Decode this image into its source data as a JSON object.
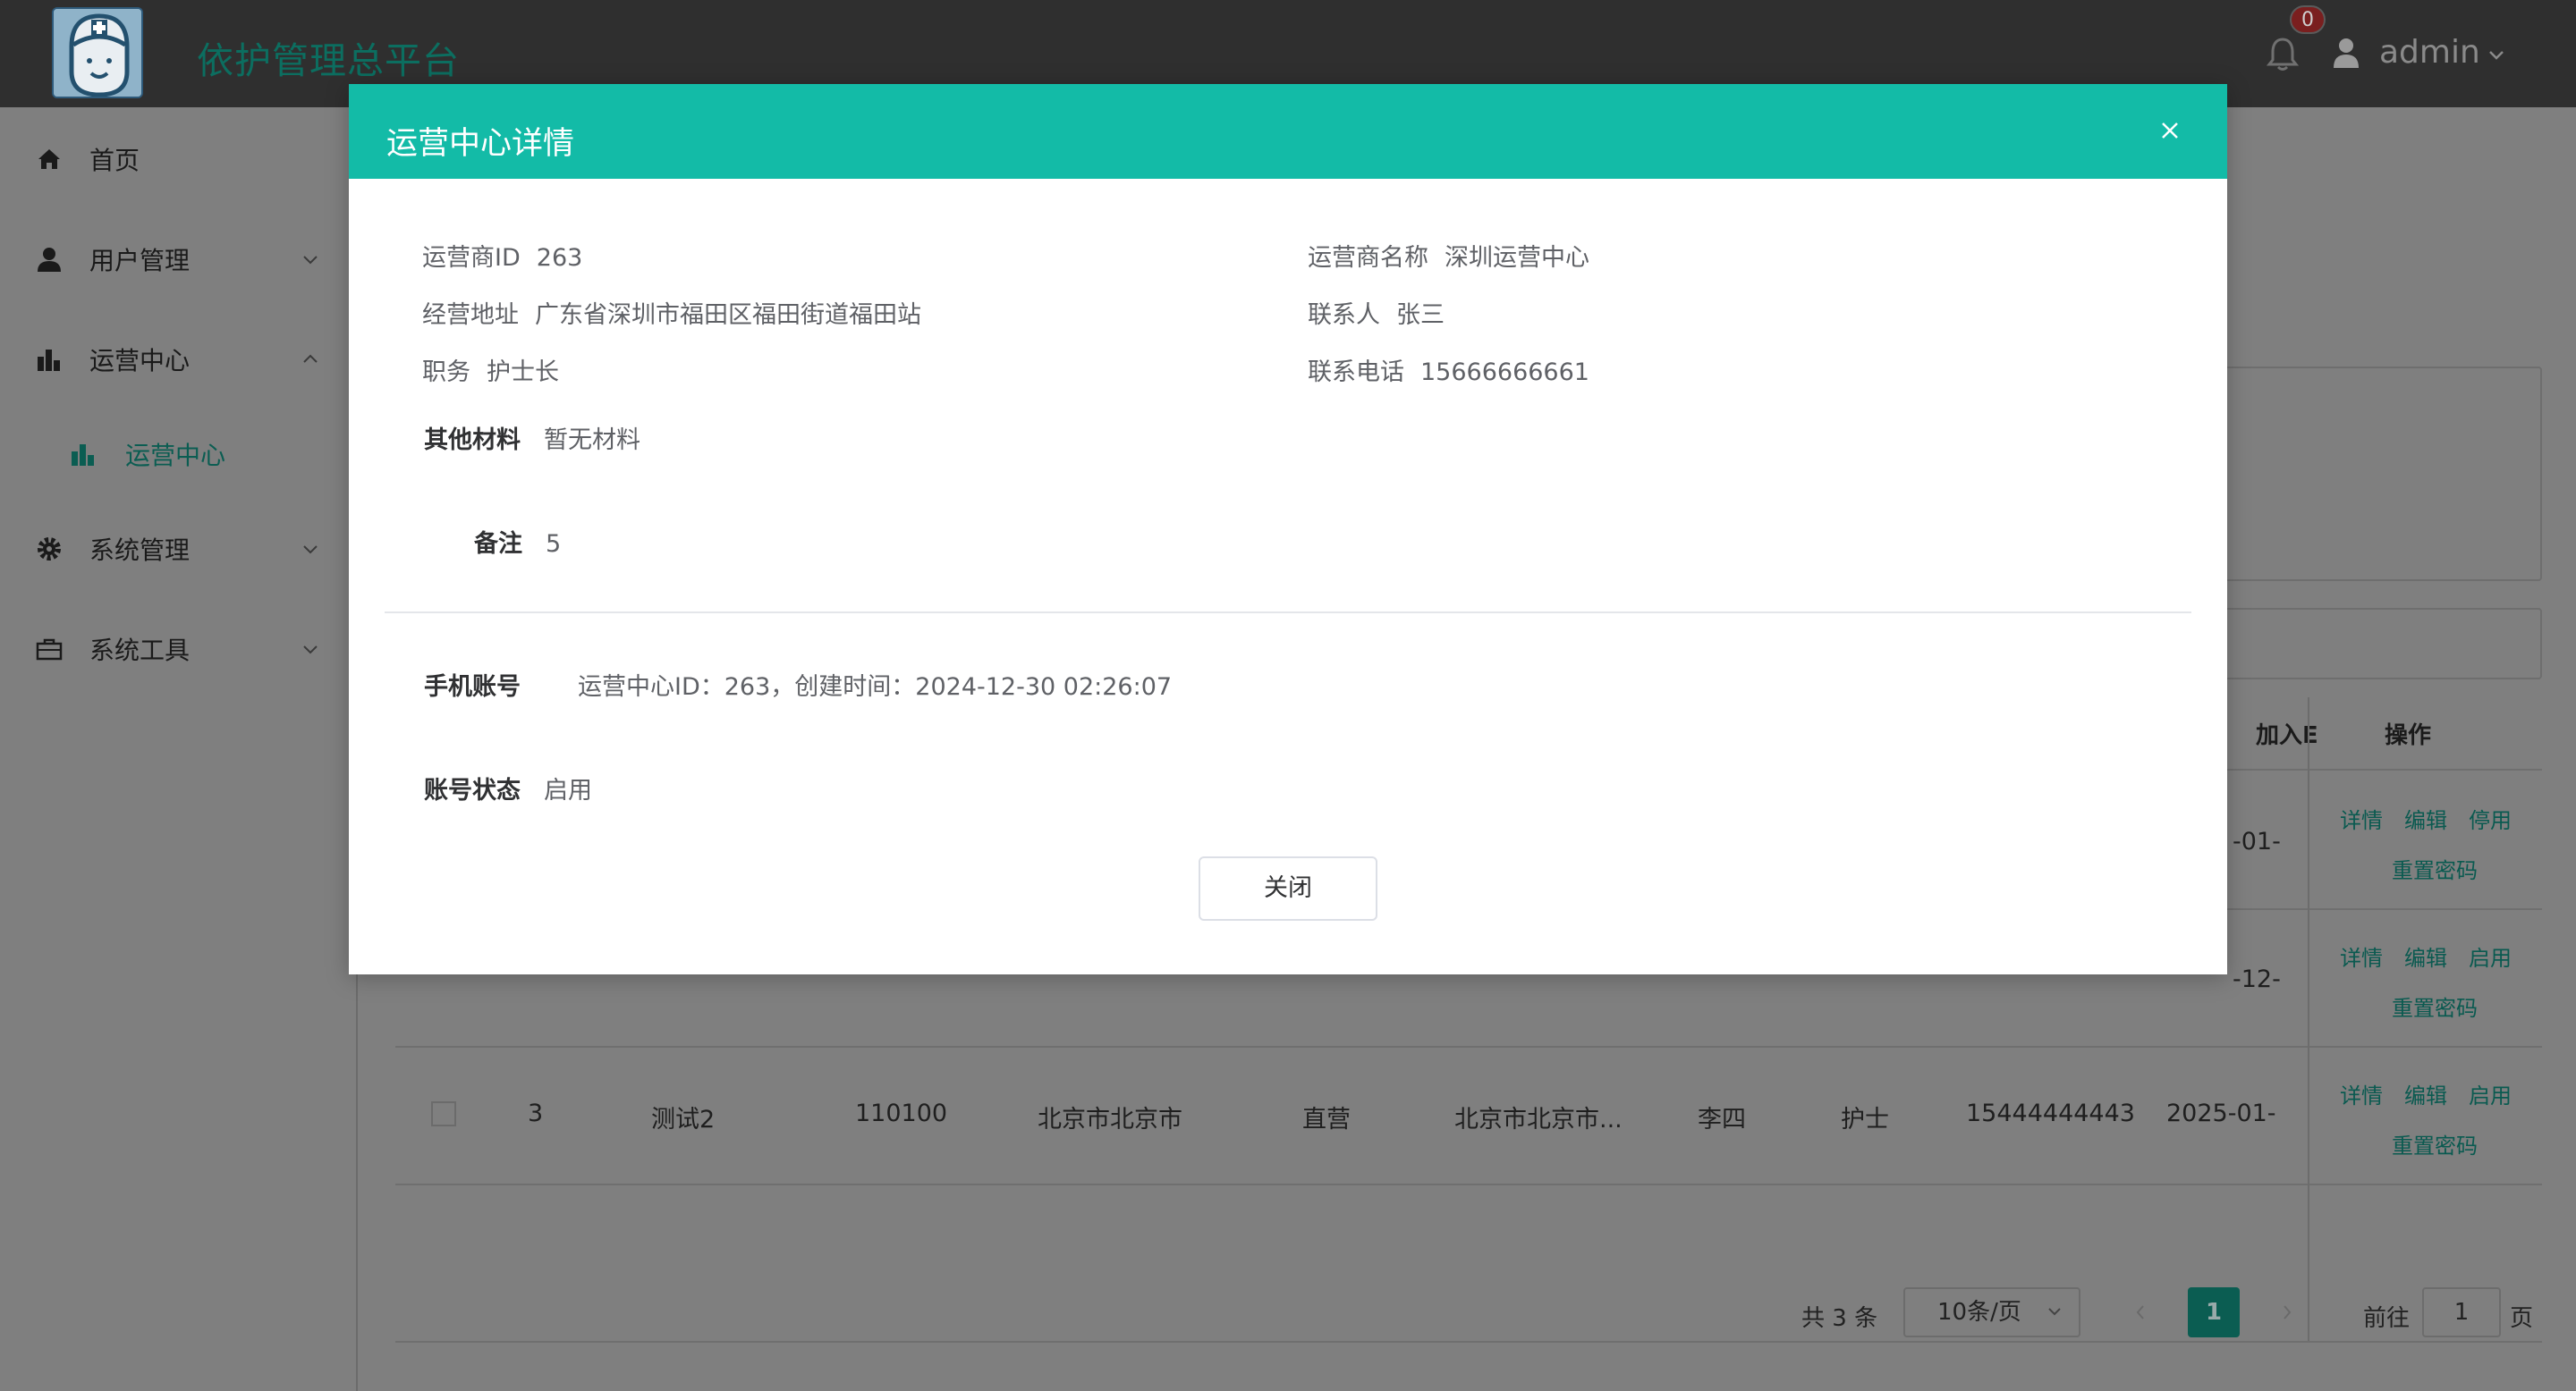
{
  "header": {
    "brand": "依护管理总平台",
    "notification_count": "0",
    "username": "admin"
  },
  "sidebar": {
    "items": [
      {
        "label": "首页",
        "icon": "home-icon"
      },
      {
        "label": "用户管理",
        "icon": "user-icon"
      },
      {
        "label": "运营中心",
        "icon": "bar-chart-icon"
      },
      {
        "label": "运营中心",
        "icon": "bar-chart-icon"
      },
      {
        "label": "系统管理",
        "icon": "gear-icon"
      },
      {
        "label": "系统工具",
        "icon": "toolbox-icon"
      }
    ]
  },
  "table": {
    "headers": {
      "join_partial": "加入E",
      "ops": "操作"
    },
    "rows": [
      {
        "date_partial": "-01-",
        "ops": [
          "详情",
          "编辑",
          "停用"
        ],
        "reset": "重置密码"
      },
      {
        "date_partial": "-12-",
        "ops": [
          "详情",
          "编辑",
          "启用"
        ],
        "reset": "重置密码"
      },
      {
        "index": "3",
        "name": "测试2",
        "code": "110100",
        "region": "北京市北京市",
        "type": "直营",
        "address": "北京市北京市...",
        "contact": "李四",
        "position": "护士",
        "phone": "15444444443",
        "date": "2025-01-",
        "ops": [
          "详情",
          "编辑",
          "启用"
        ],
        "reset": "重置密码"
      }
    ]
  },
  "pagination": {
    "total": "共 3 条",
    "page_size": "10条/页",
    "current_page": "1",
    "goto_label": "前往",
    "goto_value": "1",
    "page_suffix": "页"
  },
  "modal": {
    "title": "运营中心详情",
    "fields": {
      "operator_id_label": "运营商ID",
      "operator_id": "263",
      "operator_name_label": "运营商名称",
      "operator_name": "深圳运营中心",
      "address_label": "经营地址",
      "address": "广东省深圳市福田区福田街道福田站",
      "contact_label": "联系人",
      "contact": "张三",
      "position_label": "职务",
      "position": "护士长",
      "phone_label": "联系电话",
      "phone": "15666666661",
      "materials_label": "其他材料",
      "materials": "暂无材料",
      "remark_label": "备注",
      "remark": "5",
      "mobile_account_label": "手机账号",
      "mobile_account": "运营中心ID：263，创建时间：2024-12-30 02:26:07",
      "account_status_label": "账号状态",
      "account_status": "启用"
    },
    "close_button": "关闭"
  },
  "colors": {
    "accent": "#13bba7",
    "header_bg": "#2f2f2f",
    "overlay": "#7f7f7f"
  }
}
